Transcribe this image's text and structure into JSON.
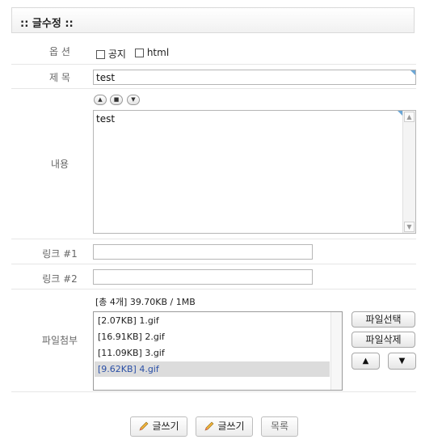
{
  "header": {
    "title": ":: 글수정 ::"
  },
  "options": {
    "label": "옵 션",
    "notice_label": "공지",
    "html_label": "html"
  },
  "subject": {
    "label": "제 목",
    "value": "test"
  },
  "content": {
    "label": "내용",
    "value": "test",
    "btn_up": "▲",
    "btn_mid": "■",
    "btn_down": "▼"
  },
  "link1": {
    "label": "링크 #1",
    "value": ""
  },
  "link2": {
    "label": "링크 #2",
    "value": ""
  },
  "attach": {
    "label": "파일첨부",
    "summary": "[총 4개] 39.70KB / 1MB",
    "files": [
      "[2.07KB] 1.gif",
      "[16.91KB] 2.gif",
      "[11.09KB] 3.gif",
      "[9.62KB] 4.gif"
    ],
    "select_btn": "파일선택",
    "delete_btn": "파일삭제",
    "up_btn": "▲",
    "down_btn": "▼"
  },
  "footer": {
    "write_btn_1": "글쓰기",
    "write_btn_2": "글쓰기",
    "list_btn": "목록"
  }
}
